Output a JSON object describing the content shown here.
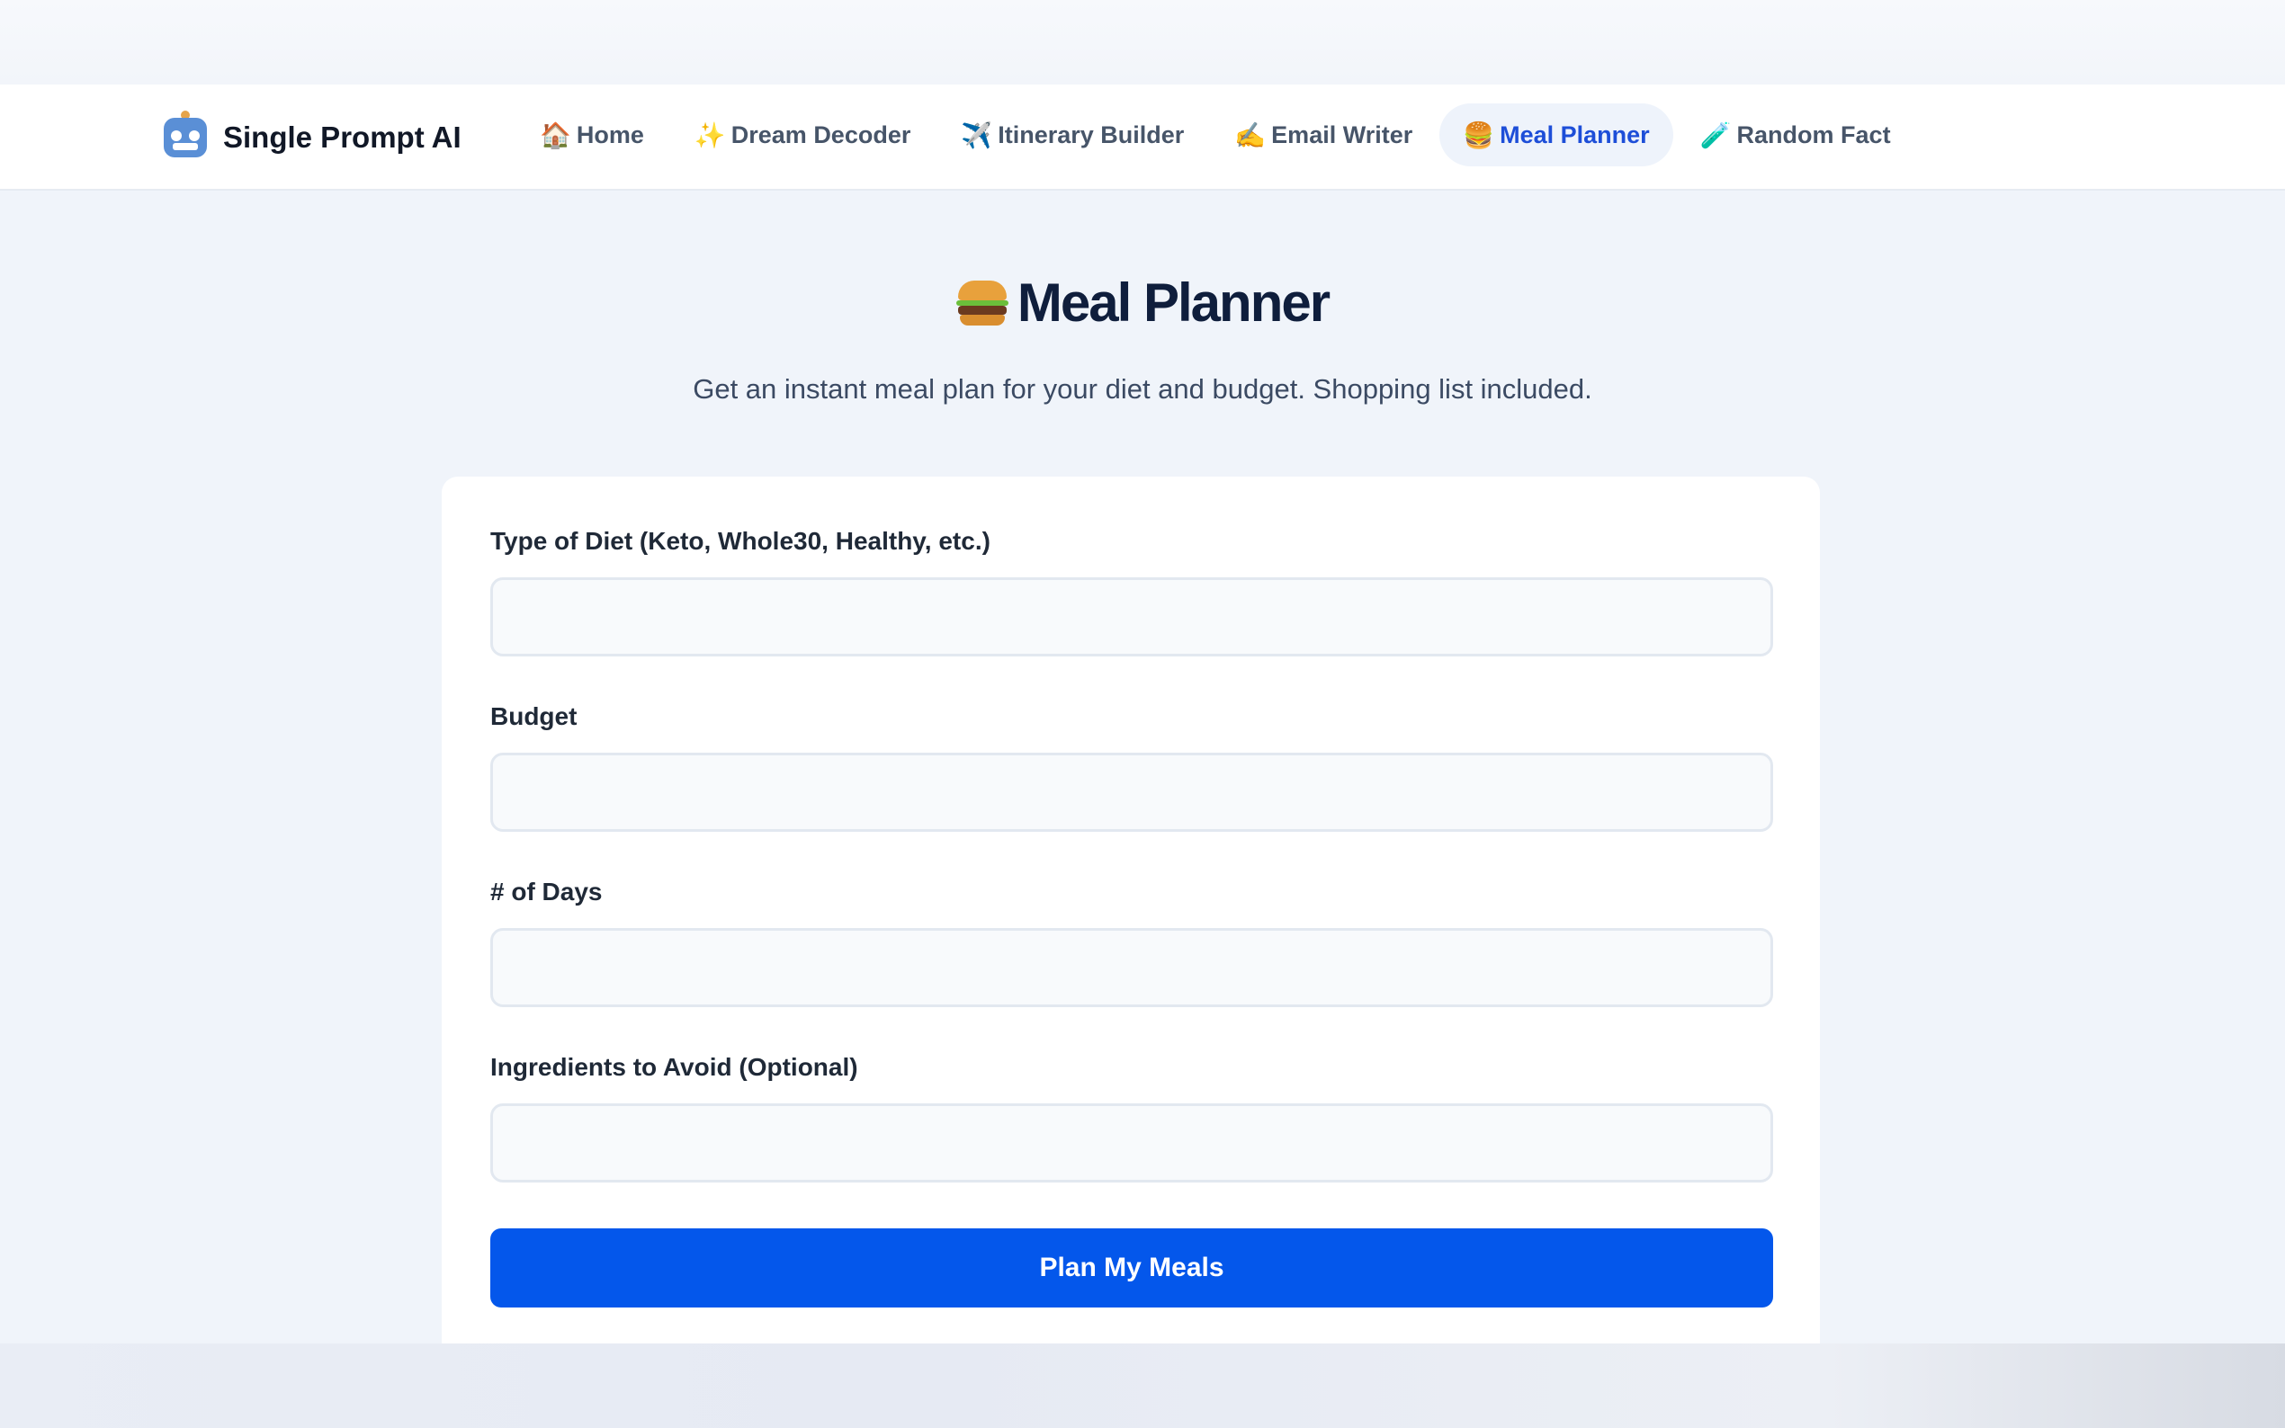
{
  "brand": {
    "name": "Single Prompt AI",
    "logo_icon": "robot-icon"
  },
  "nav": {
    "items": [
      {
        "label": "Home",
        "icon": "🏠",
        "icon_name": "house-icon",
        "active": false
      },
      {
        "label": "Dream Decoder",
        "icon": "✨",
        "icon_name": "sparkles-icon",
        "active": false
      },
      {
        "label": "Itinerary Builder",
        "icon": "✈️",
        "icon_name": "airplane-icon",
        "active": false
      },
      {
        "label": "Email Writer",
        "icon": "✍️",
        "icon_name": "writing-hand-icon",
        "active": false
      },
      {
        "label": "Meal Planner",
        "icon": "🍔",
        "icon_name": "burger-icon",
        "active": true
      },
      {
        "label": "Random Fact",
        "icon": "🧪",
        "icon_name": "test-tube-icon",
        "active": false
      }
    ]
  },
  "page": {
    "title": "Meal Planner",
    "title_icon": "burger-icon",
    "subtitle": "Get an instant meal plan for your diet and budget. Shopping list included."
  },
  "form": {
    "fields": [
      {
        "label": "Type of Diet (Keto, Whole30, Healthy, etc.)",
        "value": "",
        "placeholder": ""
      },
      {
        "label": "Budget",
        "value": "",
        "placeholder": ""
      },
      {
        "label": "# of Days",
        "value": "",
        "placeholder": ""
      },
      {
        "label": "Ingredients to Avoid (Optional)",
        "value": "",
        "placeholder": ""
      }
    ],
    "submit_label": "Plan My Meals"
  },
  "colors": {
    "accent": "#0457eb",
    "active_nav_text": "#1d4ed8",
    "active_nav_bg": "#eef3fb",
    "page_bg": "#f0f4fa",
    "title_color": "#0f1e3c"
  }
}
